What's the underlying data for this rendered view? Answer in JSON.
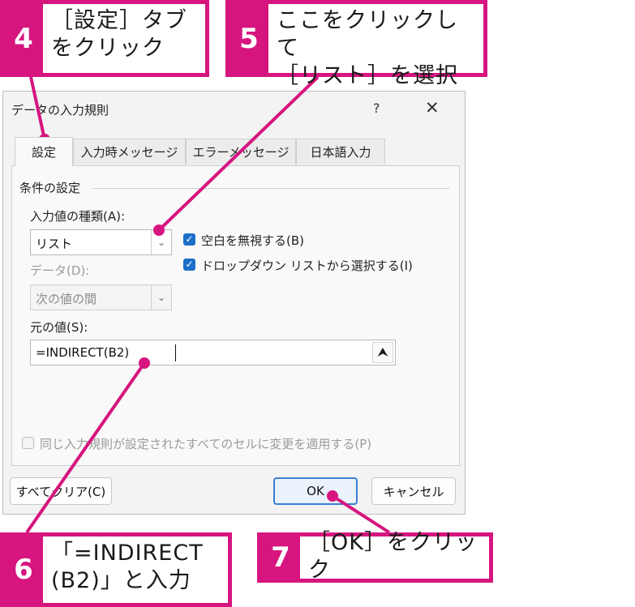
{
  "callouts": [
    {
      "num": "4",
      "text": "［設定］タブ\nをクリック"
    },
    {
      "num": "5",
      "text": "ここをクリックして\n［リスト］を選択"
    },
    {
      "num": "6",
      "text": "「=INDIRECT\n(B2)」と入力"
    },
    {
      "num": "7",
      "text": "［OK］をクリック"
    }
  ],
  "dialog": {
    "title": "データの入力規則",
    "help": "?",
    "close": "✕",
    "tabs": [
      "設定",
      "入力時メッセージ",
      "エラーメッセージ",
      "日本語入力"
    ],
    "section": "条件の設定",
    "allow_label": "入力値の種類(A):",
    "allow_value": "リスト",
    "data_label": "データ(D):",
    "data_value": "次の値の間",
    "ignore_blank": "空白を無視する(B)",
    "in_cell_dropdown": "ドロップダウン リストから選択する(I)",
    "source_label": "元の値(S):",
    "source_value": "=INDIRECT(B2)",
    "apply_all": "同じ入力規則が設定されたすべてのセルに変更を適用する(P)",
    "clear_all": "すべてクリア(C)",
    "ok": "OK",
    "cancel": "キャンセル"
  },
  "colors": {
    "accent": "#d6157f",
    "checkbox": "#1c6fc9"
  }
}
